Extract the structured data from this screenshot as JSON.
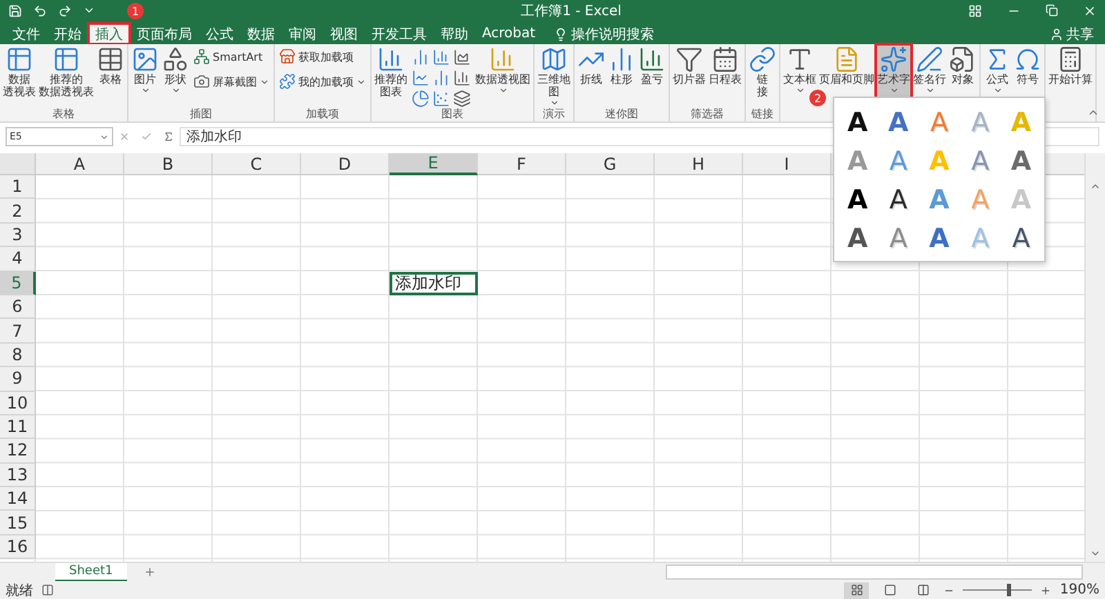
{
  "window": {
    "title": "工作簿1 - Excel"
  },
  "share": "共享",
  "tabs": [
    {
      "label": "文件",
      "selected": false,
      "highlighted": false
    },
    {
      "label": "开始",
      "selected": false,
      "highlighted": false
    },
    {
      "label": "插入",
      "selected": true,
      "highlighted": true,
      "step": "1"
    },
    {
      "label": "页面布局",
      "selected": false,
      "highlighted": false
    },
    {
      "label": "公式",
      "selected": false,
      "highlighted": false
    },
    {
      "label": "数据",
      "selected": false,
      "highlighted": false
    },
    {
      "label": "审阅",
      "selected": false,
      "highlighted": false
    },
    {
      "label": "视图",
      "selected": false,
      "highlighted": false
    },
    {
      "label": "开发工具",
      "selected": false,
      "highlighted": false
    },
    {
      "label": "帮助",
      "selected": false,
      "highlighted": false
    },
    {
      "label": "Acrobat",
      "selected": false,
      "highlighted": false
    }
  ],
  "tell_me": "操作说明搜索",
  "ribbon_groups": [
    {
      "label": "表格",
      "buttons": [
        {
          "kind": "large",
          "lines": [
            "数据",
            "透视表"
          ]
        },
        {
          "kind": "large",
          "lines": [
            "推荐的",
            "数据透视表"
          ]
        },
        {
          "kind": "large",
          "lines": [
            "表格"
          ]
        }
      ]
    },
    {
      "label": "插图",
      "buttons": [
        {
          "kind": "large",
          "lines": [
            "图片"
          ],
          "dropdown": true
        },
        {
          "kind": "large",
          "lines": [
            "形状"
          ],
          "dropdown": true
        },
        {
          "kind": "stack",
          "items": [
            {
              "label": "SmartArt",
              "dropdown": false
            },
            {
              "label": "屏幕截图",
              "dropdown": true
            }
          ]
        }
      ]
    },
    {
      "label": "加载项",
      "buttons": [
        {
          "kind": "stack",
          "items": [
            {
              "label": "获取加载项",
              "dropdown": false
            },
            {
              "label": "我的加载项",
              "dropdown": true
            }
          ]
        }
      ]
    },
    {
      "label": "图表",
      "buttons": [
        {
          "kind": "large",
          "lines": [
            "推荐的",
            "图表"
          ]
        },
        {
          "kind": "charts"
        },
        {
          "kind": "large",
          "lines": [
            "数据透视图"
          ],
          "dropdown": true
        }
      ]
    },
    {
      "label": "演示",
      "buttons": [
        {
          "kind": "large",
          "lines": [
            "三维地",
            "图"
          ],
          "dropdown": true
        }
      ]
    },
    {
      "label": "迷你图",
      "buttons": [
        {
          "kind": "large",
          "lines": [
            "折线"
          ]
        },
        {
          "kind": "large",
          "lines": [
            "柱形"
          ]
        },
        {
          "kind": "large",
          "lines": [
            "盈亏"
          ]
        }
      ]
    },
    {
      "label": "筛选器",
      "buttons": [
        {
          "kind": "large",
          "lines": [
            "切片器"
          ]
        },
        {
          "kind": "large",
          "lines": [
            "日程表"
          ]
        }
      ]
    },
    {
      "label": "链接",
      "buttons": [
        {
          "kind": "large",
          "lines": [
            "链",
            "接"
          ]
        }
      ]
    },
    {
      "buttons": [
        {
          "kind": "large",
          "lines": [
            "文本框"
          ],
          "dropdown": true
        },
        {
          "kind": "large",
          "lines": [
            "页眉和页脚"
          ],
          "step": "2"
        },
        {
          "kind": "large",
          "lines": [
            "艺术字"
          ],
          "dropdown": true,
          "highlighted": true
        },
        {
          "kind": "large",
          "lines": [
            "签名行"
          ],
          "dropdown": true
        },
        {
          "kind": "large",
          "lines": [
            "对象"
          ]
        }
      ]
    },
    {
      "buttons": [
        {
          "kind": "large",
          "lines": [
            "公式"
          ],
          "dropdown": true
        },
        {
          "kind": "large",
          "lines": [
            "符号"
          ]
        }
      ]
    },
    {
      "buttons": [
        {
          "kind": "large",
          "lines": [
            "开始计算"
          ]
        }
      ]
    }
  ],
  "wordart_styles": [
    {
      "label": "A",
      "color": "#111111",
      "kind": "fill"
    },
    {
      "label": "A",
      "color": "#4472c4",
      "kind": "fill"
    },
    {
      "label": "A",
      "color": "#ed7d31",
      "kind": "outline"
    },
    {
      "label": "A",
      "color": "#a5b4c8",
      "kind": "outline"
    },
    {
      "label": "A",
      "color": "#e6b800",
      "kind": "fill"
    },
    {
      "label": "A",
      "color": "#999999",
      "kind": "fill"
    },
    {
      "label": "A",
      "color": "#5b9bd5",
      "kind": "outline"
    },
    {
      "label": "A",
      "color": "#ffc000",
      "kind": "fill"
    },
    {
      "label": "A",
      "color": "#8496b0",
      "kind": "outline"
    },
    {
      "label": "A",
      "color": "#6b6b6b",
      "kind": "fill"
    },
    {
      "label": "A",
      "color": "#000000",
      "kind": "fill"
    },
    {
      "label": "A",
      "color": "#2b2b2b",
      "kind": "outline"
    },
    {
      "label": "A",
      "color": "#5b9bd5",
      "kind": "fill"
    },
    {
      "label": "A",
      "color": "#f4a460",
      "kind": "outline"
    },
    {
      "label": "A",
      "color": "#c8c8c8",
      "kind": "fill"
    },
    {
      "label": "A",
      "color": "#555555",
      "kind": "fill"
    },
    {
      "label": "A",
      "color": "#8c8c8c",
      "kind": "outline"
    },
    {
      "label": "A",
      "color": "#3e6fc4",
      "kind": "fill"
    },
    {
      "label": "A",
      "color": "#9dc3e6",
      "kind": "outline"
    },
    {
      "label": "A",
      "color": "#44546a",
      "kind": "outline"
    }
  ],
  "name_box": "E5",
  "formula": "添加水印",
  "columns": [
    {
      "label": "A",
      "selected": false
    },
    {
      "label": "B",
      "selected": false
    },
    {
      "label": "C",
      "selected": false
    },
    {
      "label": "D",
      "selected": false
    },
    {
      "label": "E",
      "selected": true
    },
    {
      "label": "F",
      "selected": false
    },
    {
      "label": "G",
      "selected": false
    },
    {
      "label": "H",
      "selected": false
    },
    {
      "label": "I",
      "selected": false
    }
  ],
  "rows": [
    {
      "label": "1",
      "selected": false
    },
    {
      "label": "2",
      "selected": false
    },
    {
      "label": "3",
      "selected": false
    },
    {
      "label": "4",
      "selected": false
    },
    {
      "label": "5",
      "selected": true
    },
    {
      "label": "6",
      "selected": false
    },
    {
      "label": "7",
      "selected": false
    },
    {
      "label": "8",
      "selected": false
    },
    {
      "label": "9",
      "selected": false
    },
    {
      "label": "10",
      "selected": false
    },
    {
      "label": "11",
      "selected": false
    },
    {
      "label": "12",
      "selected": false
    },
    {
      "label": "13",
      "selected": false
    },
    {
      "label": "14",
      "selected": false
    },
    {
      "label": "15",
      "selected": false
    },
    {
      "label": "16",
      "selected": false
    }
  ],
  "active_cell": {
    "value": "添加水印"
  },
  "sheets": [
    {
      "label": "Sheet1",
      "selected": true
    }
  ],
  "status": "就绪",
  "views": [
    {
      "selected": true
    },
    {
      "selected": false
    },
    {
      "selected": false
    }
  ],
  "zoom": {
    "level": 0.64,
    "reading": "190%"
  }
}
